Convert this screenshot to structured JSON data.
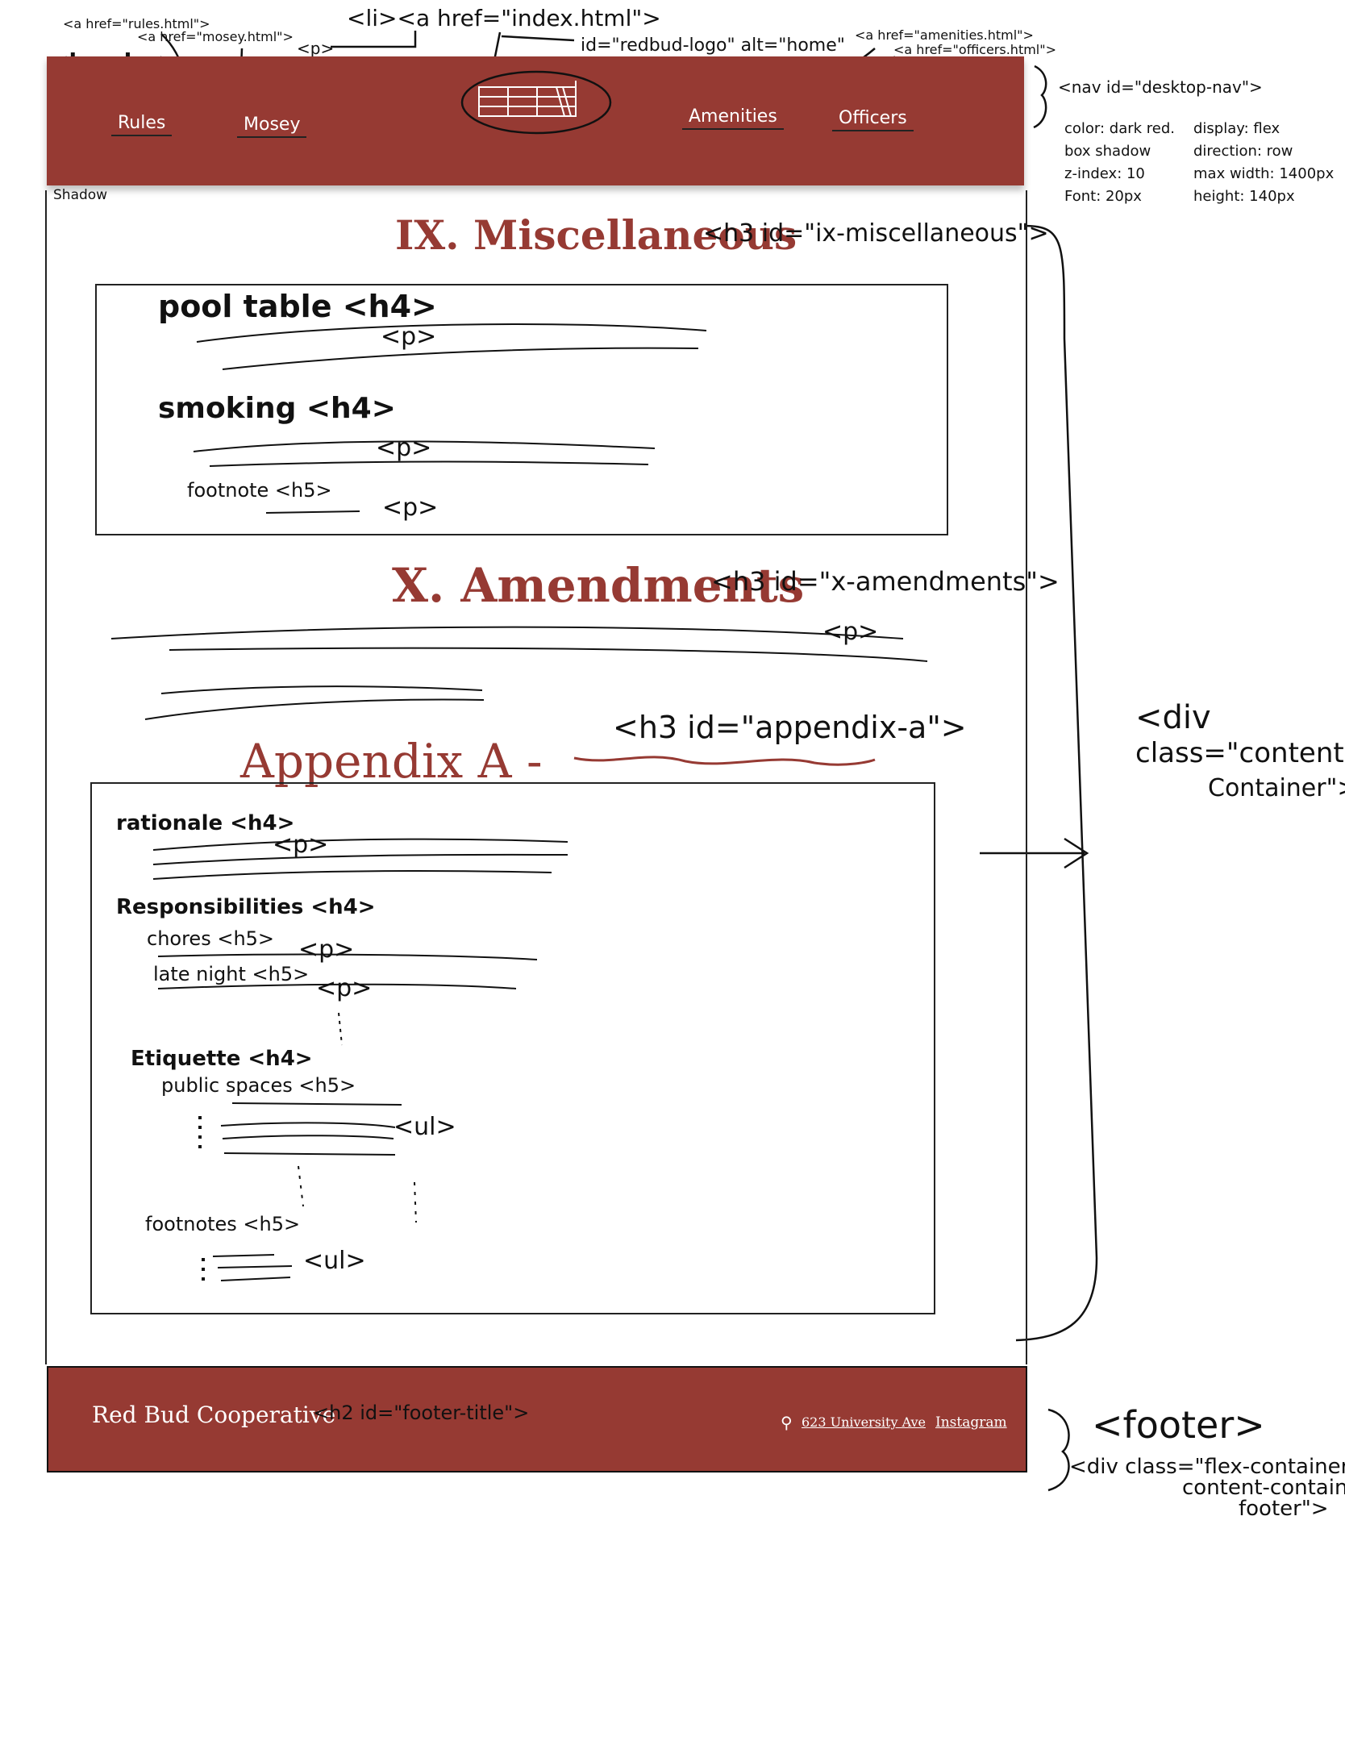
{
  "top_annotations": {
    "rules_href": "<a href=\"rules.html\">",
    "mosey_href": "<a href=\"mosey.html\">",
    "p_tag": "<p>",
    "li_index": "<li><a href=\"index.html\">",
    "logo_id": "id=\"redbud-logo\" alt=\"home\"",
    "amenities_href": "<a href=\"amenities.html\">",
    "officers_href": "<a href=\"officers.html\">",
    "header_tag": "<header>"
  },
  "header": {
    "links": [
      "Rules",
      "Mosey",
      "Amenities",
      "Officers"
    ],
    "shadow_label": "Shadow"
  },
  "nav_notes": {
    "title": "<nav id=\"desktop-nav\">",
    "left": [
      "color: dark red.",
      "box shadow",
      "z-index: 10",
      "Font: 20px"
    ],
    "right": [
      "display: flex",
      "direction: row",
      "max width: 1400px",
      "height: 140px"
    ]
  },
  "section_ix": {
    "heading": "IX. Miscellaneous",
    "tag": "<h3 id=\"ix-miscellaneous\">",
    "items": {
      "pool": "pool table <h4>",
      "p1": "<p>",
      "smoking": "smoking <h4>",
      "p2": "<p>",
      "footnote": "footnote <h5>",
      "p3": "<p>"
    }
  },
  "section_x": {
    "heading": "X. Amendments",
    "tag": "<h3 id=\"x-amendments\">",
    "p": "<p>"
  },
  "appendix": {
    "heading": "Appendix A -",
    "tag": "<h3 id=\"appendix-a\">",
    "items": {
      "rationale": "rationale <h4>",
      "p1": "<p>",
      "responsibilities": "Responsibilities <h4>",
      "chores": "chores <h5>",
      "p2": "<p>",
      "late_night": "late night <h5>",
      "p3": "<p>",
      "etiquette": "Etiquette <h4>",
      "public_spaces": "public spaces <h5>",
      "ul1": "<ul>",
      "footnotes": "footnotes <h5>",
      "ul2": "<ul>"
    }
  },
  "content_container_note": {
    "line1": "<div",
    "line2": "class=\"content-",
    "line3": "Container\">"
  },
  "footer": {
    "title": "Red Bud Cooperative",
    "title_tag": "<h2 id=\"footer-title\">",
    "address": "623 University Ave",
    "instagram": "Instagram"
  },
  "footer_note": {
    "line1": "<footer>",
    "line2": "<div class=\"flex-container",
    "line3": "content-container",
    "line4": "footer\">"
  }
}
